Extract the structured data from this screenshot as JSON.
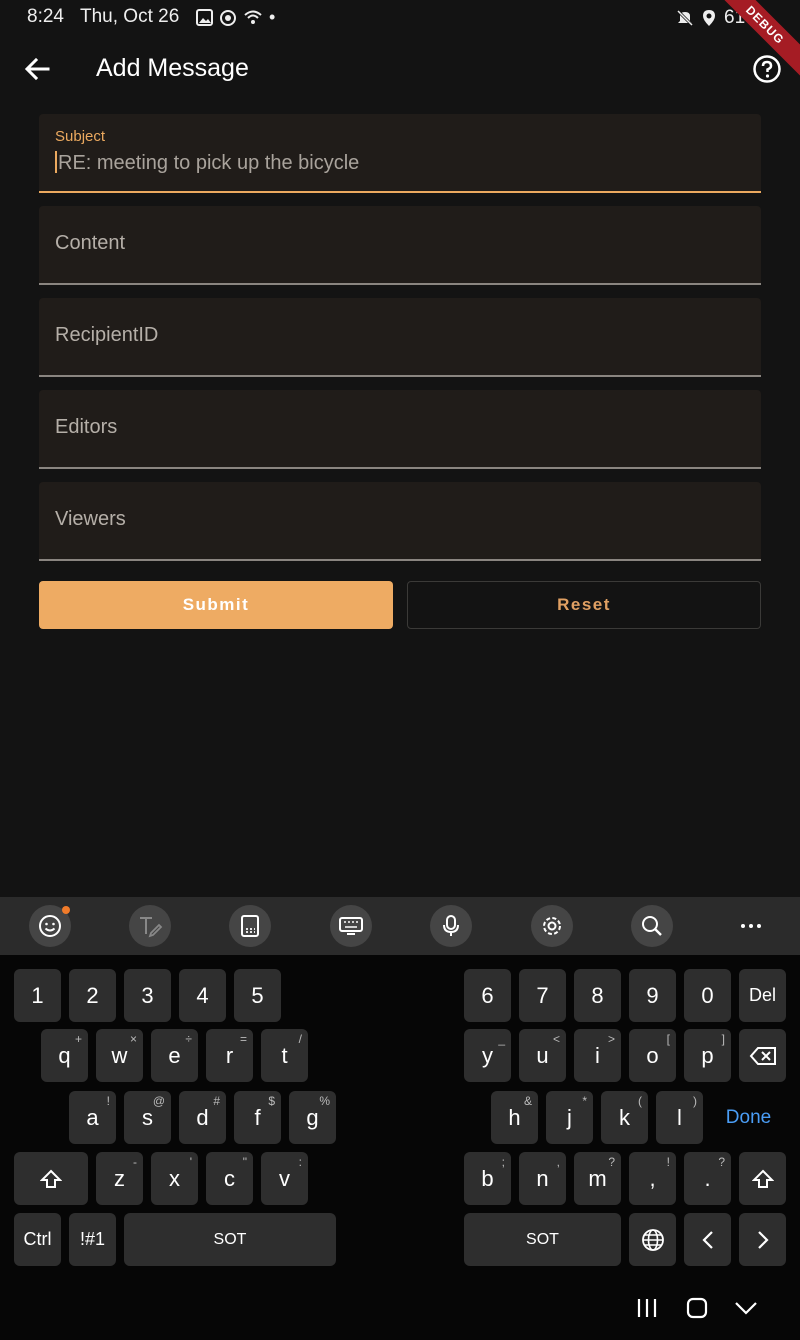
{
  "status_bar": {
    "time": "8:24",
    "date": "Thu, Oct 26",
    "battery": "61%",
    "debug_label": "DEBUG"
  },
  "app_bar": {
    "title": "Add Message"
  },
  "form": {
    "subject": {
      "label": "Subject",
      "value": "RE: meeting to pick up the bicycle"
    },
    "content": {
      "placeholder": "Content"
    },
    "recipient": {
      "placeholder": "RecipientID"
    },
    "editors": {
      "placeholder": "Editors"
    },
    "viewers": {
      "placeholder": "Viewers"
    },
    "submit_label": "Submit",
    "reset_label": "Reset"
  },
  "keyboard": {
    "toolbar_icons": [
      "emoji-icon",
      "handwriting-icon",
      "clipboard-icon",
      "keyboard-layout-icon",
      "microphone-icon",
      "settings-icon",
      "search-icon",
      "more-icon"
    ],
    "row1_left": [
      "1",
      "2",
      "3",
      "4",
      "5"
    ],
    "row1_right": [
      "6",
      "7",
      "8",
      "9",
      "0",
      "Del"
    ],
    "row2_left": [
      {
        "k": "q",
        "s": "+"
      },
      {
        "k": "w",
        "s": "×"
      },
      {
        "k": "e",
        "s": "÷"
      },
      {
        "k": "r",
        "s": "="
      },
      {
        "k": "t",
        "s": "/"
      }
    ],
    "row2_right": [
      {
        "k": "y",
        "s": "_"
      },
      {
        "k": "u",
        "s": "<"
      },
      {
        "k": "i",
        "s": ">"
      },
      {
        "k": "o",
        "s": "["
      },
      {
        "k": "p",
        "s": "]"
      }
    ],
    "row3_left": [
      {
        "k": "a",
        "s": "!"
      },
      {
        "k": "s",
        "s": "@"
      },
      {
        "k": "d",
        "s": "#"
      },
      {
        "k": "f",
        "s": "$"
      },
      {
        "k": "g",
        "s": "%"
      }
    ],
    "row3_right": [
      {
        "k": "h",
        "s": "&"
      },
      {
        "k": "j",
        "s": "*"
      },
      {
        "k": "k",
        "s": "("
      },
      {
        "k": "l",
        "s": ")"
      }
    ],
    "done_label": "Done",
    "row4_left": [
      {
        "k": "z",
        "s": "-"
      },
      {
        "k": "x",
        "s": "'"
      },
      {
        "k": "c",
        "s": "\""
      },
      {
        "k": "v",
        "s": ":"
      }
    ],
    "row4_right": [
      {
        "k": "b",
        "s": ";"
      },
      {
        "k": "n",
        "s": ","
      },
      {
        "k": "m",
        "s": "?"
      },
      {
        "k": ",",
        "s": "!"
      },
      {
        "k": ".",
        "s": "?"
      }
    ],
    "ctrl_label": "Ctrl",
    "symbols_label": "!#1",
    "space_label": "SOT"
  },
  "colors": {
    "accent": "#eeab63",
    "background": "#131313",
    "field_bg": "#201c19",
    "done_blue": "#4a9df5"
  }
}
